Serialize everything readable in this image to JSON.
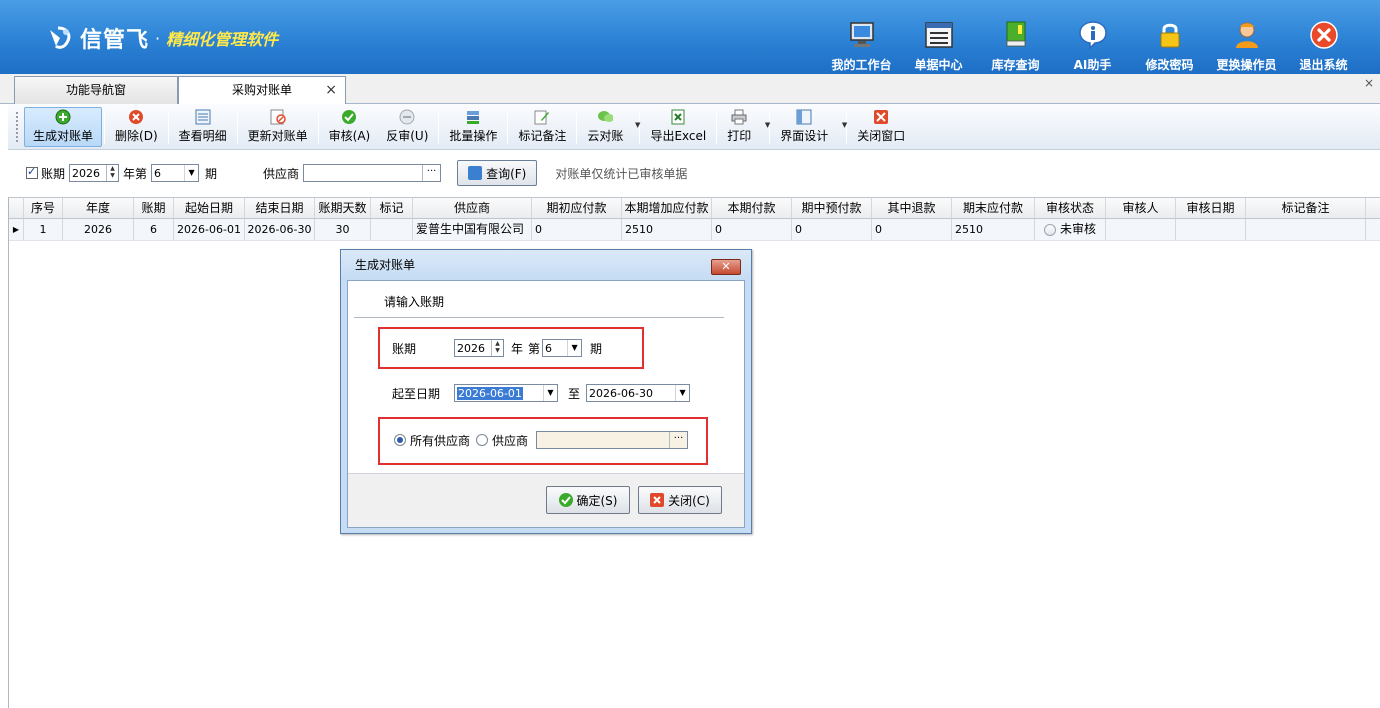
{
  "header": {
    "brand_name": "信管飞",
    "dot": "·",
    "slogan": "精细化管理软件",
    "nav": [
      {
        "label": "我的工作台",
        "icon": "monitor-icon"
      },
      {
        "label": "单据中心",
        "icon": "document-list-icon"
      },
      {
        "label": "库存查询",
        "icon": "inventory-book-icon"
      },
      {
        "label": "AI助手",
        "icon": "info-bubble-icon"
      },
      {
        "label": "修改密码",
        "icon": "lock-icon"
      },
      {
        "label": "更换操作员",
        "icon": "user-icon"
      },
      {
        "label": "退出系统",
        "icon": "exit-icon"
      }
    ]
  },
  "tabs": {
    "nav_tab": "功能导航窗",
    "active_tab": "采购对账单",
    "close_symbol": "×",
    "close_all": "×"
  },
  "toolbar": {
    "generate": "生成对账单",
    "delete": "删除(D)",
    "view_detail": "查看明细",
    "update": "更新对账单",
    "audit": "审核(A)",
    "unaudit": "反审(U)",
    "batch": "批量操作",
    "mark_note": "标记备注",
    "cloud": "云对账",
    "export": "导出Excel",
    "print": "打印",
    "ui_design": "界面设计",
    "close_window": "关闭窗口"
  },
  "filter": {
    "period_label": "账期",
    "year": "2026",
    "year_label": "年第",
    "period": "6",
    "period_suffix": "期",
    "supplier_label": "供应商",
    "supplier_value": "",
    "query_button": "查询(F)",
    "note": "对账单仅统计已审核单据"
  },
  "grid": {
    "columns": [
      "序号",
      "年度",
      "账期",
      "起始日期",
      "结束日期",
      "账期天数",
      "标记",
      "供应商",
      "期初应付款",
      "本期增加应付款",
      "本期付款",
      "期中预付款",
      "其中退款",
      "期末应付款",
      "审核状态",
      "审核人",
      "审核日期",
      "标记备注"
    ],
    "rows": [
      {
        "seq": "1",
        "year": "2026",
        "period": "6",
        "start": "2026-06-01",
        "end": "2026-06-30",
        "days": "30",
        "mark": "",
        "supplier": "爱普生中国有限公司",
        "opening": "0",
        "increase": "2510",
        "paid": "0",
        "prepaid": "0",
        "refund": "0",
        "closing": "2510",
        "status": "未审核",
        "auditor": "",
        "audit_date": "",
        "note": ""
      }
    ]
  },
  "dialog": {
    "title": "生成对账单",
    "close": "✕",
    "prompt": "请输入账期",
    "period_label": "账期",
    "year": "2026",
    "year_label": "年",
    "nth_label": "第",
    "period": "6",
    "period_suffix": "期",
    "range_label": "起至日期",
    "start_date": "2026-06-01",
    "to_label": "至",
    "end_date": "2026-06-30",
    "all_suppliers": "所有供应商",
    "supplier": "供应商",
    "supplier_value": "",
    "ok": "确定(S)",
    "cancel": "关闭(C)"
  },
  "colors": {
    "header_blue": "#2e84d6",
    "slogan_yellow": "#ffe84a",
    "highlight_red": "#e03030",
    "selection_blue": "#3a7bd5"
  }
}
